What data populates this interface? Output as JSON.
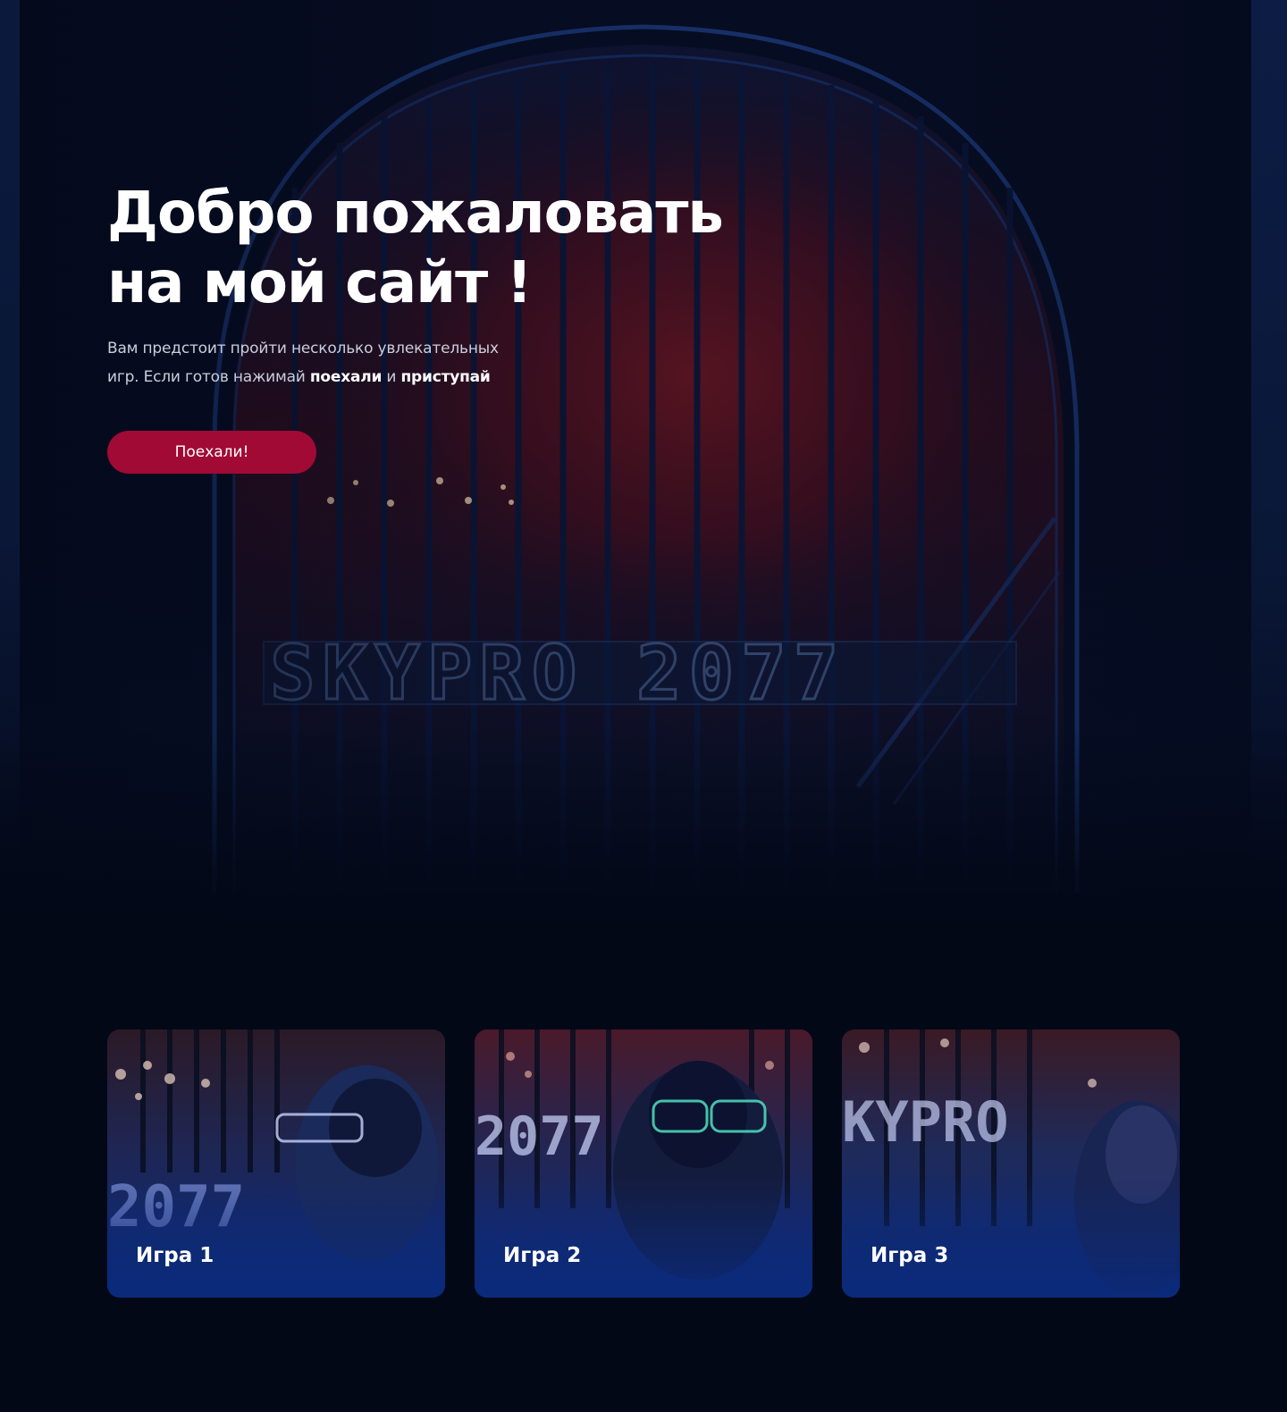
{
  "hero": {
    "title_line1": "Добро пожаловать",
    "title_line2": "на мой сайт !",
    "text_line1": "Вам предстоит пройти несколько увлекательных",
    "text_line2_prefix": "игр. Если готов нажимай ",
    "text_bold1": "поехали",
    "text_mid": " и ",
    "text_bold2": "приступай",
    "button_label": "Поехали!",
    "sign_text": "SKYPRO 2077"
  },
  "cards": [
    {
      "label": "Игра 1"
    },
    {
      "label": "Игра 2"
    },
    {
      "label": "Игра 3"
    }
  ],
  "colors": {
    "background": "#030817",
    "button": "#a10a35",
    "card_gradient": "#0b2a7a"
  }
}
